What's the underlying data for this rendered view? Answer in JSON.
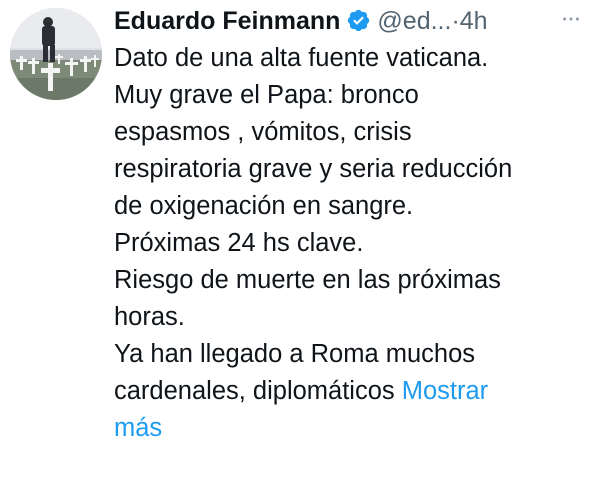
{
  "tweet": {
    "author": {
      "display_name": "Eduardo Feinmann",
      "handle": "@ed...",
      "verified": true,
      "avatar_icon": "profile-photo"
    },
    "separator": "·",
    "timestamp": "4h",
    "more_icon": "more-horizontal-icon",
    "text_lines": [
      "Dato de una alta fuente vaticana.",
      "Muy grave el Papa: bronco",
      "espasmos , vómitos, crisis",
      "respiratoria grave y seria reducción",
      "de oxigenación en sangre.",
      "Próximas 24 hs clave.",
      "Riesgo de muerte en las próximas",
      "horas.",
      "Ya han llegado a Roma muchos",
      "cardenales, diplomáticos"
    ],
    "show_more_part1": "Mostrar",
    "show_more_part2": "más"
  },
  "colors": {
    "text": "#0f1419",
    "secondary": "#536471",
    "link": "#1d9bf0",
    "verified_badge": "#1d9bf0"
  }
}
